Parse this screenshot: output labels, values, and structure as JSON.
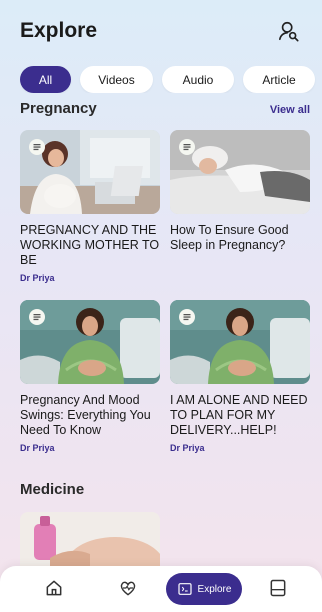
{
  "header": {
    "title": "Explore",
    "profile_icon": "user-search-icon"
  },
  "filters": [
    {
      "label": "All",
      "active": true
    },
    {
      "label": "Videos",
      "active": false
    },
    {
      "label": "Audio",
      "active": false
    },
    {
      "label": "Article",
      "active": false
    }
  ],
  "sections": {
    "pregnancy": {
      "title": "Pregnancy",
      "view_all": "View all"
    },
    "medicine": {
      "title": "Medicine"
    }
  },
  "cards": [
    {
      "title": "PREGNANCY AND THE WORKING MOTHER TO BE",
      "author": "Dr Priya",
      "badge_icon": "article-icon"
    },
    {
      "title": "How To Ensure Good Sleep in Pregnancy?",
      "author": "",
      "badge_icon": "article-icon"
    },
    {
      "title": "Pregnancy And Mood Swings: Everything You Need To Know",
      "author": "Dr Priya",
      "badge_icon": "article-icon"
    },
    {
      "title": "I AM ALONE AND NEED TO PLAN FOR MY DELIVERY...HELP!",
      "author": "Dr Priya",
      "badge_icon": "article-icon"
    }
  ],
  "bottom_nav": {
    "items": [
      {
        "icon": "home-icon"
      },
      {
        "icon": "heart-pulse-icon"
      },
      {
        "icon": "explore-icon",
        "label": "Explore",
        "active": true
      },
      {
        "icon": "bookmark-icon"
      }
    ]
  },
  "colors": {
    "accent": "#3b2d8e",
    "badge": "#f5f7f1"
  }
}
